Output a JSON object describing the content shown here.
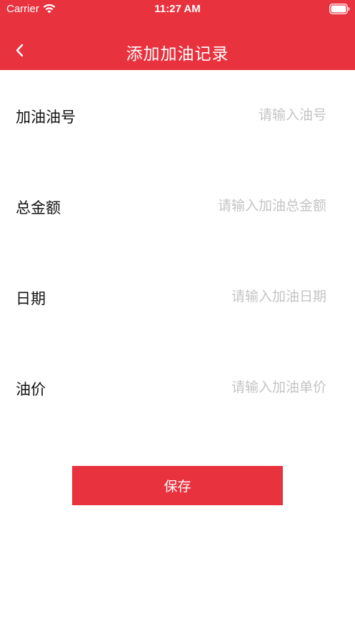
{
  "status_bar": {
    "carrier": "Carrier",
    "time": "11:27 AM"
  },
  "nav": {
    "back_icon": "chevron-left-icon",
    "title": "添加加油记录"
  },
  "form": {
    "fields": [
      {
        "label": "加油油号",
        "placeholder": "请输入油号",
        "value": ""
      },
      {
        "label": "总金额",
        "placeholder": "请输入加油总金额",
        "value": ""
      },
      {
        "label": "日期",
        "placeholder": "请输入加油日期",
        "value": ""
      },
      {
        "label": "油价",
        "placeholder": "请输入加油单价",
        "value": ""
      }
    ]
  },
  "save_button": {
    "label": "保存"
  },
  "colors": {
    "primary": "#e8333f",
    "placeholder": "#c4c4c4",
    "text": "#111111",
    "background": "#ffffff"
  }
}
